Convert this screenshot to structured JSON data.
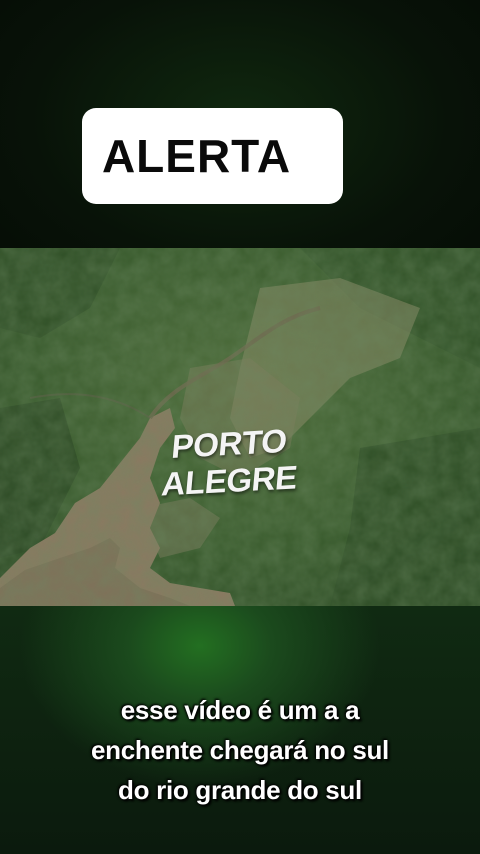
{
  "alert_banner": {
    "text": "ALERTA",
    "background": "#ffffff",
    "text_color": "#0a0a0a"
  },
  "map": {
    "city_label_line1": "PORTO",
    "city_label_line2": "ALEGRE",
    "water_color": "#8a7a62",
    "land_color": "#3d5f2f"
  },
  "subtitles": {
    "line1": "esse vídeo é um a a",
    "line2": "enchente chegará no sul",
    "line3": "do rio grande do sul"
  },
  "colors": {
    "background_dark": "#071207",
    "glow_green": "#236f21"
  }
}
